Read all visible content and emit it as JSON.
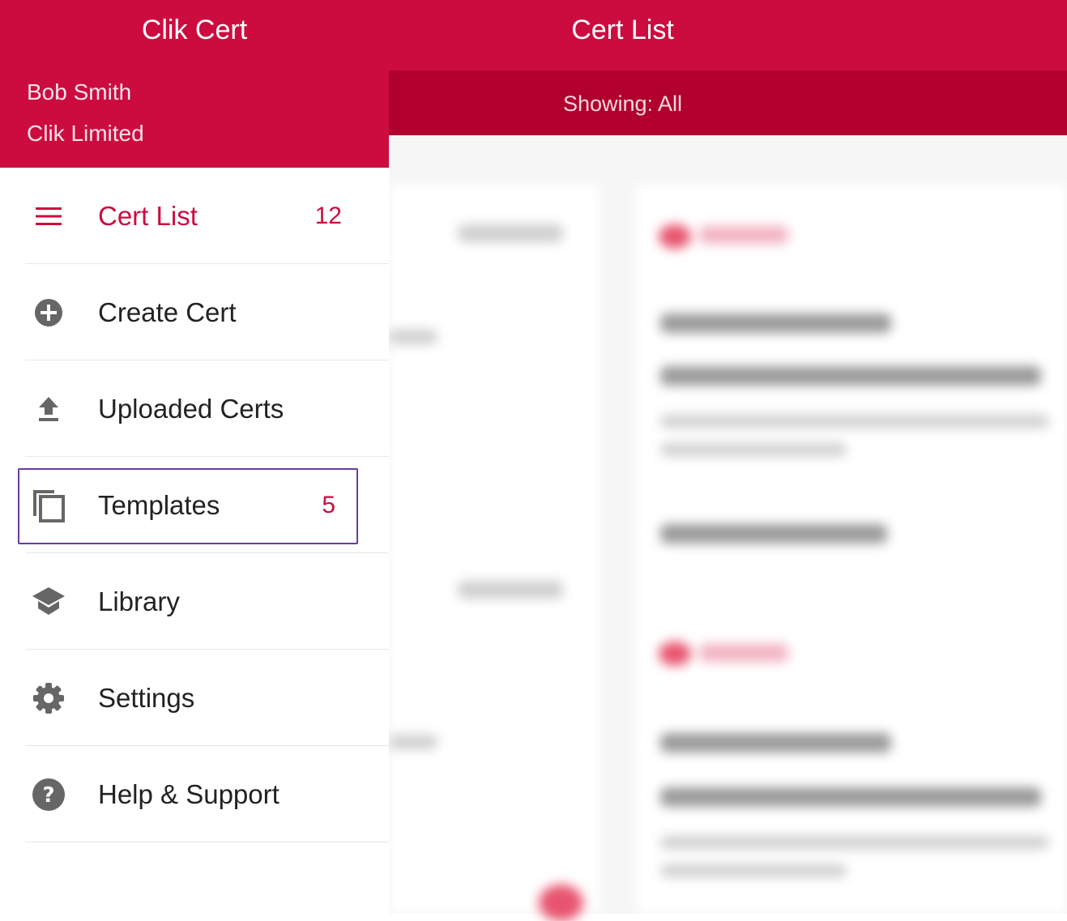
{
  "drawer": {
    "app_title": "Clik Cert",
    "user_name": "Bob Smith",
    "company": "Clik Limited",
    "items": [
      {
        "label": "Cert List",
        "count": "12",
        "icon": "menu-icon"
      },
      {
        "label": "Create Cert",
        "count": "",
        "icon": "add-circle-icon"
      },
      {
        "label": "Uploaded Certs",
        "count": "",
        "icon": "upload-icon"
      },
      {
        "label": "Templates",
        "count": "5",
        "icon": "copy-icon"
      },
      {
        "label": "Library",
        "count": "",
        "icon": "school-icon"
      },
      {
        "label": "Settings",
        "count": "",
        "icon": "gear-icon"
      },
      {
        "label": "Help & Support",
        "count": "",
        "icon": "help-icon"
      }
    ]
  },
  "main": {
    "title": "Cert List",
    "filter": "Showing: All"
  },
  "colors": {
    "brand": "#cc0c3f",
    "filter_bar": "#b1002c",
    "icon": "#666666",
    "highlight": "#6a3d9a"
  }
}
